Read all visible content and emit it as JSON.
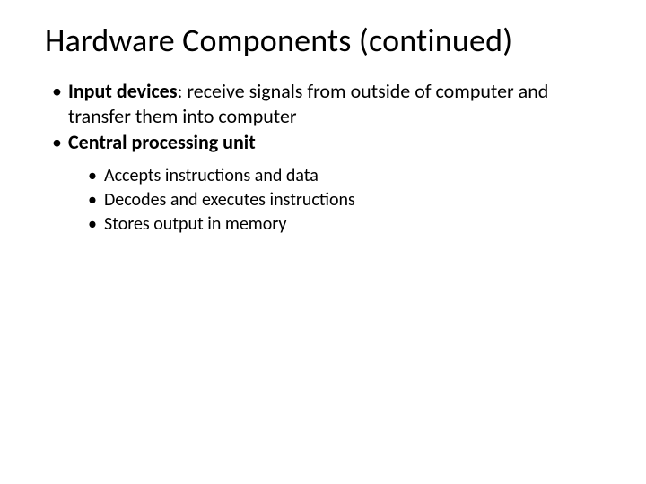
{
  "title": "Hardware Components (continued)",
  "bullets": [
    {
      "bold": "Input devices",
      "rest": ": receive signals from outside of computer and transfer them into computer"
    },
    {
      "bold": "Central processing unit",
      "rest": ""
    }
  ],
  "subbullets": [
    "Accepts instructions and data",
    "Decodes and executes instructions",
    "Stores output in memory"
  ]
}
